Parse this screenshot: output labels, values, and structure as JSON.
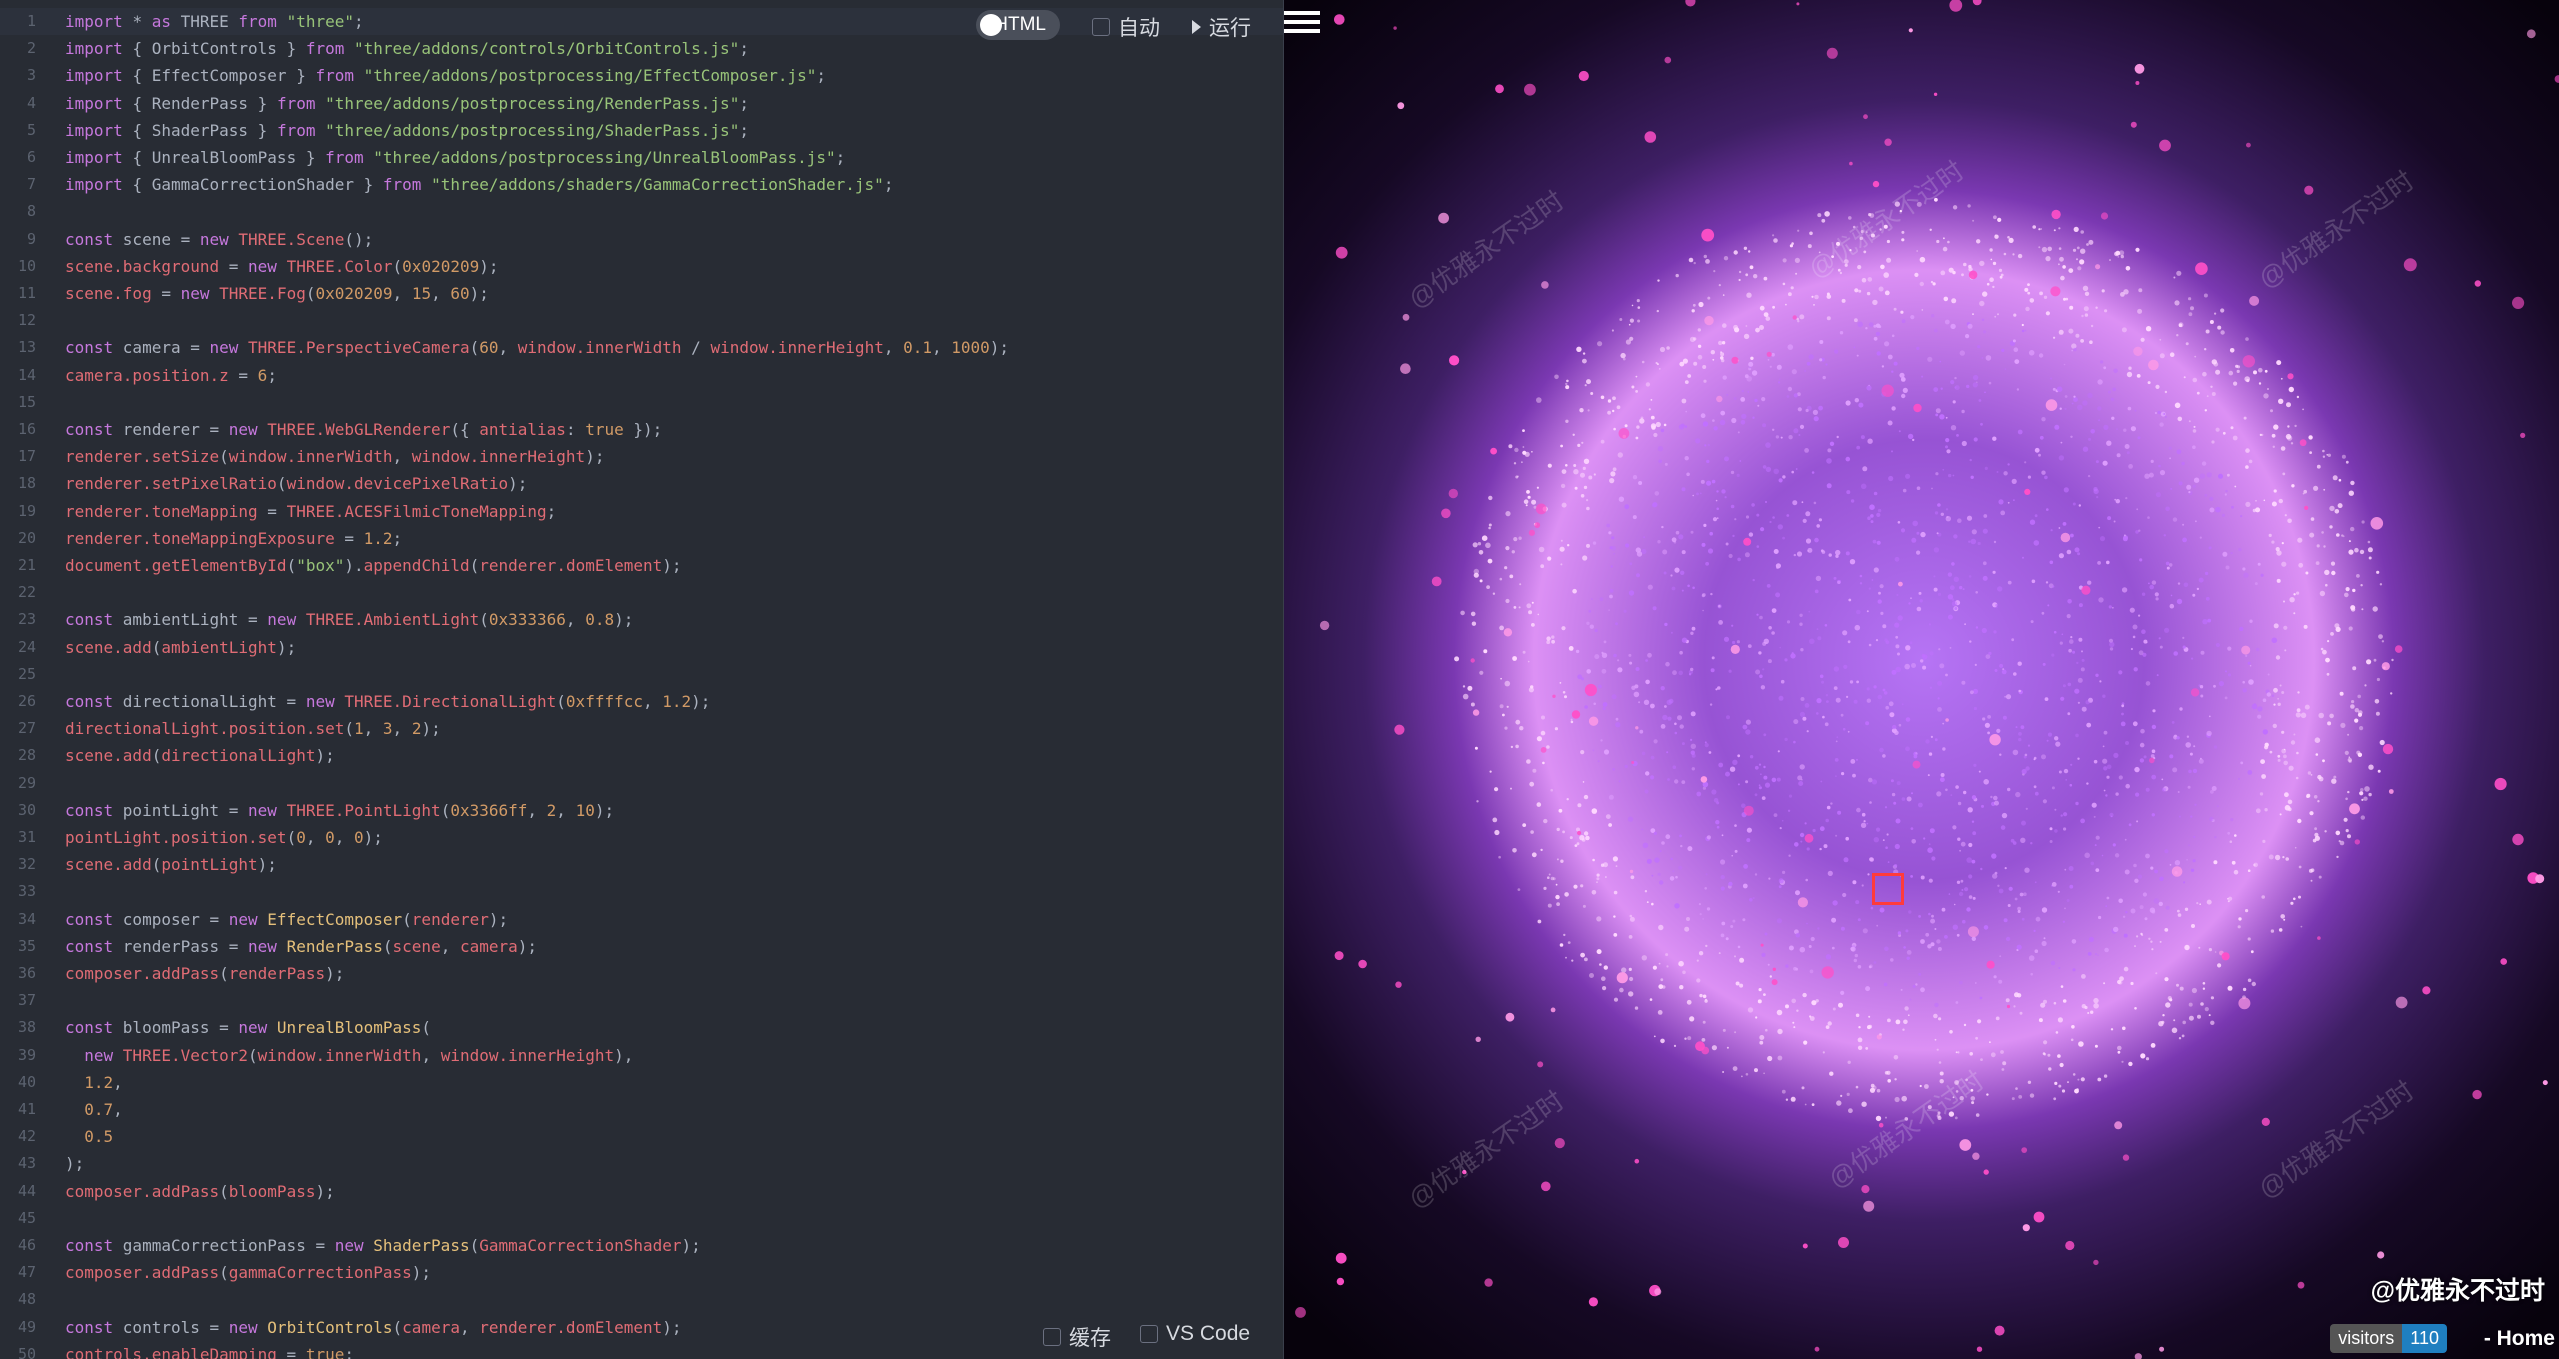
{
  "editor": {
    "lines": [
      [
        [
          "kw",
          "import "
        ],
        [
          "def",
          "* "
        ],
        [
          "kw",
          "as "
        ],
        [
          "def",
          "THREE "
        ],
        [
          "kw",
          "from "
        ],
        [
          "str",
          "\"three\""
        ],
        [
          "def",
          ";"
        ]
      ],
      [
        [
          "kw",
          "import "
        ],
        [
          "def",
          "{ OrbitControls } "
        ],
        [
          "kw",
          "from "
        ],
        [
          "str",
          "\"three/addons/controls/OrbitControls.js\""
        ],
        [
          "def",
          ";"
        ]
      ],
      [
        [
          "kw",
          "import "
        ],
        [
          "def",
          "{ EffectComposer } "
        ],
        [
          "kw",
          "from "
        ],
        [
          "str",
          "\"three/addons/postprocessing/EffectComposer.js\""
        ],
        [
          "def",
          ";"
        ]
      ],
      [
        [
          "kw",
          "import "
        ],
        [
          "def",
          "{ RenderPass } "
        ],
        [
          "kw",
          "from "
        ],
        [
          "str",
          "\"three/addons/postprocessing/RenderPass.js\""
        ],
        [
          "def",
          ";"
        ]
      ],
      [
        [
          "kw",
          "import "
        ],
        [
          "def",
          "{ ShaderPass } "
        ],
        [
          "kw",
          "from "
        ],
        [
          "str",
          "\"three/addons/postprocessing/ShaderPass.js\""
        ],
        [
          "def",
          ";"
        ]
      ],
      [
        [
          "kw",
          "import "
        ],
        [
          "def",
          "{ UnrealBloomPass } "
        ],
        [
          "kw",
          "from "
        ],
        [
          "str",
          "\"three/addons/postprocessing/UnrealBloomPass.js\""
        ],
        [
          "def",
          ";"
        ]
      ],
      [
        [
          "kw",
          "import "
        ],
        [
          "def",
          "{ GammaCorrectionShader } "
        ],
        [
          "kw",
          "from "
        ],
        [
          "str",
          "\"three/addons/shaders/GammaCorrectionShader.js\""
        ],
        [
          "def",
          ";"
        ]
      ],
      [],
      [
        [
          "kw",
          "const "
        ],
        [
          "def",
          "scene = "
        ],
        [
          "kw",
          "new "
        ],
        [
          "prop",
          "THREE.Scene"
        ],
        [
          "def",
          "();"
        ]
      ],
      [
        [
          "prop",
          "scene.background"
        ],
        [
          "def",
          " = "
        ],
        [
          "kw",
          "new "
        ],
        [
          "prop",
          "THREE.Color"
        ],
        [
          "def",
          "("
        ],
        [
          "num",
          "0x020209"
        ],
        [
          "def",
          ");"
        ]
      ],
      [
        [
          "prop",
          "scene.fog"
        ],
        [
          "def",
          " = "
        ],
        [
          "kw",
          "new "
        ],
        [
          "prop",
          "THREE.Fog"
        ],
        [
          "def",
          "("
        ],
        [
          "num",
          "0x020209"
        ],
        [
          "def",
          ", "
        ],
        [
          "num",
          "15"
        ],
        [
          "def",
          ", "
        ],
        [
          "num",
          "60"
        ],
        [
          "def",
          ");"
        ]
      ],
      [],
      [
        [
          "kw",
          "const "
        ],
        [
          "def",
          "camera = "
        ],
        [
          "kw",
          "new "
        ],
        [
          "prop",
          "THREE.PerspectiveCamera"
        ],
        [
          "def",
          "("
        ],
        [
          "num",
          "60"
        ],
        [
          "def",
          ", "
        ],
        [
          "prop",
          "window.innerWidth"
        ],
        [
          "def",
          " / "
        ],
        [
          "prop",
          "window.innerHeight"
        ],
        [
          "def",
          ", "
        ],
        [
          "num",
          "0.1"
        ],
        [
          "def",
          ", "
        ],
        [
          "num",
          "1000"
        ],
        [
          "def",
          ");"
        ]
      ],
      [
        [
          "prop",
          "camera.position.z"
        ],
        [
          "def",
          " = "
        ],
        [
          "num",
          "6"
        ],
        [
          "def",
          ";"
        ]
      ],
      [],
      [
        [
          "kw",
          "const "
        ],
        [
          "def",
          "renderer = "
        ],
        [
          "kw",
          "new "
        ],
        [
          "prop",
          "THREE.WebGLRenderer"
        ],
        [
          "def",
          "({ "
        ],
        [
          "prop",
          "antialias"
        ],
        [
          "def",
          ": "
        ],
        [
          "num",
          "true"
        ],
        [
          "def",
          " });"
        ]
      ],
      [
        [
          "prop",
          "renderer.setSize"
        ],
        [
          "def",
          "("
        ],
        [
          "prop",
          "window.innerWidth"
        ],
        [
          "def",
          ", "
        ],
        [
          "prop",
          "window.innerHeight"
        ],
        [
          "def",
          ");"
        ]
      ],
      [
        [
          "prop",
          "renderer.setPixelRatio"
        ],
        [
          "def",
          "("
        ],
        [
          "prop",
          "window.devicePixelRatio"
        ],
        [
          "def",
          ");"
        ]
      ],
      [
        [
          "prop",
          "renderer.toneMapping"
        ],
        [
          "def",
          " = "
        ],
        [
          "prop",
          "THREE.ACESFilmicToneMapping"
        ],
        [
          "def",
          ";"
        ]
      ],
      [
        [
          "prop",
          "renderer.toneMappingExposure"
        ],
        [
          "def",
          " = "
        ],
        [
          "num",
          "1.2"
        ],
        [
          "def",
          ";"
        ]
      ],
      [
        [
          "prop",
          "document.getElementById"
        ],
        [
          "def",
          "("
        ],
        [
          "str",
          "\"box\""
        ],
        [
          "def",
          ")."
        ],
        [
          "prop",
          "appendChild"
        ],
        [
          "def",
          "("
        ],
        [
          "prop",
          "renderer.domElement"
        ],
        [
          "def",
          ");"
        ]
      ],
      [],
      [
        [
          "kw",
          "const "
        ],
        [
          "def",
          "ambientLight = "
        ],
        [
          "kw",
          "new "
        ],
        [
          "prop",
          "THREE.AmbientLight"
        ],
        [
          "def",
          "("
        ],
        [
          "num",
          "0x333366"
        ],
        [
          "def",
          ", "
        ],
        [
          "num",
          "0.8"
        ],
        [
          "def",
          ");"
        ]
      ],
      [
        [
          "prop",
          "scene.add"
        ],
        [
          "def",
          "("
        ],
        [
          "prop",
          "ambientLight"
        ],
        [
          "def",
          ");"
        ]
      ],
      [],
      [
        [
          "kw",
          "const "
        ],
        [
          "def",
          "directionalLight = "
        ],
        [
          "kw",
          "new "
        ],
        [
          "prop",
          "THREE.DirectionalLight"
        ],
        [
          "def",
          "("
        ],
        [
          "num",
          "0xffffcc"
        ],
        [
          "def",
          ", "
        ],
        [
          "num",
          "1.2"
        ],
        [
          "def",
          ");"
        ]
      ],
      [
        [
          "prop",
          "directionalLight.position.set"
        ],
        [
          "def",
          "("
        ],
        [
          "num",
          "1"
        ],
        [
          "def",
          ", "
        ],
        [
          "num",
          "3"
        ],
        [
          "def",
          ", "
        ],
        [
          "num",
          "2"
        ],
        [
          "def",
          ");"
        ]
      ],
      [
        [
          "prop",
          "scene.add"
        ],
        [
          "def",
          "("
        ],
        [
          "prop",
          "directionalLight"
        ],
        [
          "def",
          ");"
        ]
      ],
      [],
      [
        [
          "kw",
          "const "
        ],
        [
          "def",
          "pointLight = "
        ],
        [
          "kw",
          "new "
        ],
        [
          "prop",
          "THREE.PointLight"
        ],
        [
          "def",
          "("
        ],
        [
          "num",
          "0x3366ff"
        ],
        [
          "def",
          ", "
        ],
        [
          "num",
          "2"
        ],
        [
          "def",
          ", "
        ],
        [
          "num",
          "10"
        ],
        [
          "def",
          ");"
        ]
      ],
      [
        [
          "prop",
          "pointLight.position.set"
        ],
        [
          "def",
          "("
        ],
        [
          "num",
          "0"
        ],
        [
          "def",
          ", "
        ],
        [
          "num",
          "0"
        ],
        [
          "def",
          ", "
        ],
        [
          "num",
          "0"
        ],
        [
          "def",
          ");"
        ]
      ],
      [
        [
          "prop",
          "scene.add"
        ],
        [
          "def",
          "("
        ],
        [
          "prop",
          "pointLight"
        ],
        [
          "def",
          ");"
        ]
      ],
      [],
      [
        [
          "kw",
          "const "
        ],
        [
          "def",
          "composer = "
        ],
        [
          "kw",
          "new "
        ],
        [
          "cls",
          "EffectComposer"
        ],
        [
          "def",
          "("
        ],
        [
          "prop",
          "renderer"
        ],
        [
          "def",
          ");"
        ]
      ],
      [
        [
          "kw",
          "const "
        ],
        [
          "def",
          "renderPass = "
        ],
        [
          "kw",
          "new "
        ],
        [
          "cls",
          "RenderPass"
        ],
        [
          "def",
          "("
        ],
        [
          "prop",
          "scene"
        ],
        [
          "def",
          ", "
        ],
        [
          "prop",
          "camera"
        ],
        [
          "def",
          ");"
        ]
      ],
      [
        [
          "prop",
          "composer.addPass"
        ],
        [
          "def",
          "("
        ],
        [
          "prop",
          "renderPass"
        ],
        [
          "def",
          ");"
        ]
      ],
      [],
      [
        [
          "kw",
          "const "
        ],
        [
          "def",
          "bloomPass = "
        ],
        [
          "kw",
          "new "
        ],
        [
          "cls",
          "UnrealBloomPass"
        ],
        [
          "def",
          "("
        ]
      ],
      [
        [
          "def",
          "  "
        ],
        [
          "kw",
          "new "
        ],
        [
          "prop",
          "THREE.Vector2"
        ],
        [
          "def",
          "("
        ],
        [
          "prop",
          "window.innerWidth"
        ],
        [
          "def",
          ", "
        ],
        [
          "prop",
          "window.innerHeight"
        ],
        [
          "def",
          "),"
        ]
      ],
      [
        [
          "def",
          "  "
        ],
        [
          "num",
          "1.2"
        ],
        [
          "def",
          ","
        ]
      ],
      [
        [
          "def",
          "  "
        ],
        [
          "num",
          "0.7"
        ],
        [
          "def",
          ","
        ]
      ],
      [
        [
          "def",
          "  "
        ],
        [
          "num",
          "0.5"
        ]
      ],
      [
        [
          "def",
          ");"
        ]
      ],
      [
        [
          "prop",
          "composer.addPass"
        ],
        [
          "def",
          "("
        ],
        [
          "prop",
          "bloomPass"
        ],
        [
          "def",
          ");"
        ]
      ],
      [],
      [
        [
          "kw",
          "const "
        ],
        [
          "def",
          "gammaCorrectionPass = "
        ],
        [
          "kw",
          "new "
        ],
        [
          "cls",
          "ShaderPass"
        ],
        [
          "def",
          "("
        ],
        [
          "prop",
          "GammaCorrectionShader"
        ],
        [
          "def",
          ");"
        ]
      ],
      [
        [
          "prop",
          "composer.addPass"
        ],
        [
          "def",
          "("
        ],
        [
          "prop",
          "gammaCorrectionPass"
        ],
        [
          "def",
          ");"
        ]
      ],
      [],
      [
        [
          "kw",
          "const "
        ],
        [
          "def",
          "controls = "
        ],
        [
          "kw",
          "new "
        ],
        [
          "cls",
          "OrbitControls"
        ],
        [
          "def",
          "("
        ],
        [
          "prop",
          "camera"
        ],
        [
          "def",
          ", "
        ],
        [
          "prop",
          "renderer.domElement"
        ],
        [
          "def",
          ");"
        ]
      ],
      [
        [
          "prop",
          "controls.enableDamping"
        ],
        [
          "def",
          " = "
        ],
        [
          "num",
          "true"
        ],
        [
          "def",
          ";"
        ]
      ]
    ]
  },
  "toolbar": {
    "html_toggle": "HTML",
    "auto_label": "自动",
    "run_label": "运行",
    "cache_label": "缓存",
    "vscode_label": "VS Code"
  },
  "preview": {
    "watermark": "@优雅永不过时",
    "handle": "@优雅永不过时",
    "visitors_label": "visitors",
    "visitors_count": "110",
    "home_label": "- Home"
  }
}
